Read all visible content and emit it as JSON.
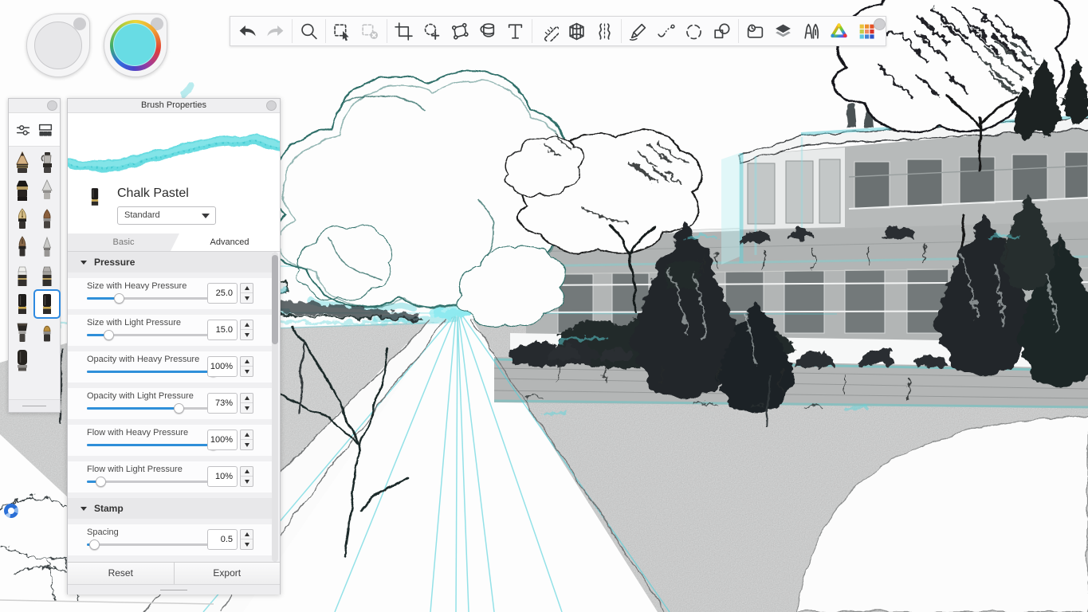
{
  "toolbar": {
    "groups": [
      [
        {
          "name": "undo"
        },
        {
          "name": "redo",
          "disabled": true
        }
      ],
      [
        {
          "name": "zoom"
        }
      ],
      [
        {
          "name": "select"
        },
        {
          "name": "deselect",
          "disabled": true
        }
      ],
      [
        {
          "name": "crop"
        },
        {
          "name": "lasso-add"
        },
        {
          "name": "polygon-select"
        },
        {
          "name": "fill"
        },
        {
          "name": "text"
        }
      ],
      [
        {
          "name": "ruler"
        },
        {
          "name": "perspective"
        },
        {
          "name": "symmetry"
        }
      ],
      [
        {
          "name": "brush-pen"
        },
        {
          "name": "steady-stroke"
        },
        {
          "name": "ellipse-guide"
        },
        {
          "name": "shapes"
        }
      ],
      [
        {
          "name": "timelapse"
        },
        {
          "name": "layers"
        },
        {
          "name": "brush-library"
        },
        {
          "name": "color-wheel"
        },
        {
          "name": "color-palette"
        }
      ]
    ],
    "palette_colors": [
      "#eac23c",
      "#ec8f2c",
      "#e55226",
      "#c3ce4c",
      "#ef8a64",
      "#d8342b",
      "#5bc6df",
      "#3f83d6",
      "#2f54c6"
    ]
  },
  "pucks": {
    "color_fill": "#68dce4"
  },
  "brush_palette": {
    "brushes": [
      {
        "name": "pencil",
        "shape": "pencil"
      },
      {
        "name": "airbrush",
        "shape": "airbrush"
      },
      {
        "name": "marker-chisel",
        "shape": "chisel"
      },
      {
        "name": "cone-eraser",
        "shape": "cone"
      },
      {
        "name": "fountain-pen",
        "shape": "nib"
      },
      {
        "name": "smudge-brush",
        "shape": "smudge"
      },
      {
        "name": "ink-pen",
        "shape": "nib2"
      },
      {
        "name": "arrow-tip",
        "shape": "cone2"
      },
      {
        "name": "marker-light",
        "shape": "markerw"
      },
      {
        "name": "marker-gray",
        "shape": "markerg"
      },
      {
        "name": "chalk",
        "shape": "chalk"
      },
      {
        "name": "chalk-pastel",
        "shape": "chalk",
        "selected": true
      },
      {
        "name": "flat-brush",
        "shape": "flat"
      },
      {
        "name": "round-pastel",
        "shape": "round"
      },
      {
        "name": "paint-brush",
        "shape": "bigbrush"
      }
    ]
  },
  "panel": {
    "title": "Brush Properties",
    "brush_name": "Chalk Pastel",
    "brush_type": "Standard",
    "tabs": [
      "Basic",
      "Advanced"
    ],
    "active_tab": "Advanced",
    "stroke_color": "#5ad8de",
    "sections": [
      {
        "title": "Pressure",
        "rows": [
          {
            "label": "Size with Heavy Pressure",
            "value": "25.0",
            "pct": 25
          },
          {
            "label": "Size with Light Pressure",
            "value": "15.0",
            "pct": 17
          },
          {
            "label": "Opacity with Heavy Pressure",
            "value": "100%",
            "pct": 100
          },
          {
            "label": "Opacity with Light Pressure",
            "value": "73%",
            "pct": 73
          },
          {
            "label": "Flow with Heavy Pressure",
            "value": "100%",
            "pct": 100
          },
          {
            "label": "Flow with Light Pressure",
            "value": "10%",
            "pct": 11
          }
        ]
      },
      {
        "title": "Stamp",
        "rows": [
          {
            "label": "Spacing",
            "value": "0.5",
            "pct": 6
          }
        ]
      }
    ],
    "buttons": [
      "Reset",
      "Export"
    ]
  }
}
